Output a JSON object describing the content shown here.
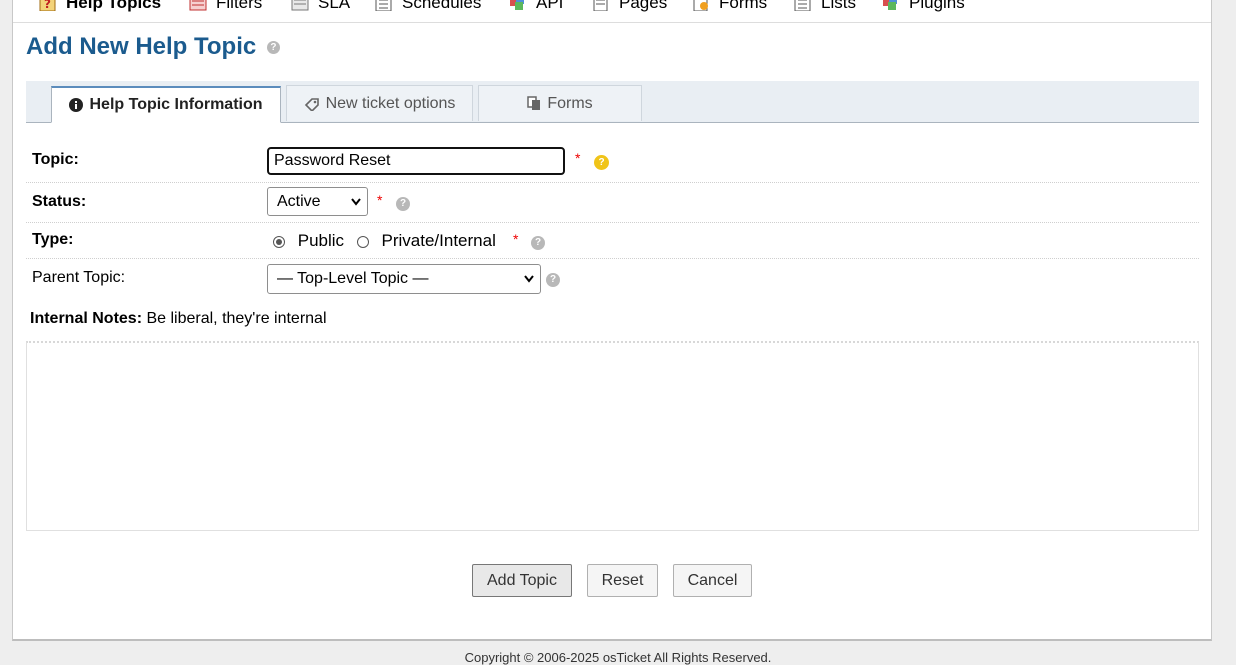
{
  "nav": {
    "items": [
      {
        "label": "Help Topics",
        "icon": "help-topics-icon"
      },
      {
        "label": "Filters",
        "icon": "filters-icon"
      },
      {
        "label": "SLA",
        "icon": "sla-icon"
      },
      {
        "label": "Schedules",
        "icon": "schedules-icon"
      },
      {
        "label": "API",
        "icon": "api-icon"
      },
      {
        "label": "Pages",
        "icon": "pages-icon"
      },
      {
        "label": "Forms",
        "icon": "forms-icon"
      },
      {
        "label": "Lists",
        "icon": "lists-icon"
      },
      {
        "label": "Plugins",
        "icon": "plugins-icon"
      }
    ]
  },
  "page": {
    "title": "Add New Help Topic"
  },
  "tabs": [
    {
      "label": "Help Topic Information",
      "icon": "info-icon",
      "active": true
    },
    {
      "label": "New ticket options",
      "icon": "ticket-icon",
      "active": false
    },
    {
      "label": "Forms",
      "icon": "forms-copy-icon",
      "active": false
    }
  ],
  "form": {
    "topic": {
      "label": "Topic:",
      "value": "Password Reset",
      "required": "*"
    },
    "status": {
      "label": "Status:",
      "value": "Active",
      "required": "*"
    },
    "type": {
      "label": "Type:",
      "options": [
        "Public",
        "Private/Internal"
      ],
      "selected": "Public",
      "required": "*"
    },
    "parent": {
      "label": "Parent Topic:",
      "value": "— Top-Level Topic —"
    },
    "notes": {
      "label": "Internal Notes:",
      "hint": "Be liberal, they're internal",
      "value": ""
    }
  },
  "buttons": {
    "add": "Add Topic",
    "reset": "Reset",
    "cancel": "Cancel"
  },
  "footer": {
    "text": "Copyright © 2006-2025 osTicket All Rights Reserved."
  },
  "colors": {
    "title": "#1b5b8e",
    "required": "#ee0000",
    "help_yellow": "#f0c419",
    "help_gray": "#b8b8b8"
  }
}
